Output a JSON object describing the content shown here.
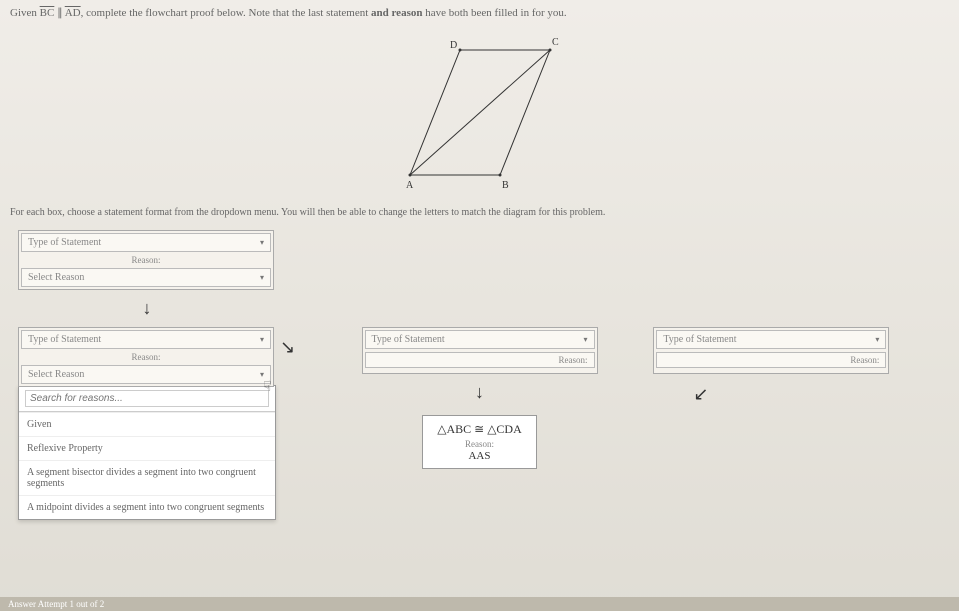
{
  "header": {
    "text_before": "Given ",
    "seg1": "BC",
    "parallel": " ∥ ",
    "seg2": "AD",
    "text_after": ", complete the flowchart proof below. Note that the last statement ",
    "bold1": "and reason",
    "text_after2": " have both been filled in for you."
  },
  "diagram": {
    "labels": {
      "A": "A",
      "B": "B",
      "C": "C",
      "D": "D"
    }
  },
  "subheader": "For each box, choose a statement format from the dropdown menu. You will then be able to change the letters to match the diagram for this problem.",
  "box1": {
    "statement_placeholder": "Type of Statement",
    "reason_label": "Reason:",
    "reason_placeholder": "Select Reason"
  },
  "arrow_down": "↓",
  "row2": {
    "left": {
      "statement_placeholder": "Type of Statement",
      "reason_label": "Reason:",
      "reason_placeholder": "Select Reason",
      "dropdown": {
        "search_placeholder": "Search for reasons...",
        "items": [
          "Given",
          "Reflexive Property",
          "A segment bisector divides a segment into two congruent segments",
          "A midpoint divides a segment into two congruent segments"
        ]
      }
    },
    "mid": {
      "statement_placeholder": "Type of Statement",
      "reason_label": "Reason:"
    },
    "right": {
      "statement_placeholder": "Type of Statement",
      "reason_label": "Reason:"
    }
  },
  "arrows": {
    "down_right": "↘",
    "down": "↓",
    "down_left": "↙"
  },
  "final": {
    "statement": "△ABC ≅ △CDA",
    "reason_label": "Reason:",
    "reason_value": "AAS"
  },
  "footer": {
    "left": "Answer   Attempt 1 out of 2"
  }
}
